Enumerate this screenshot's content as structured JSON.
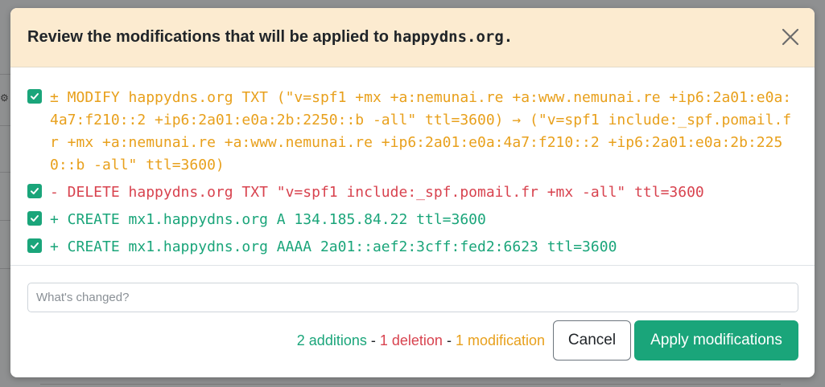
{
  "modal": {
    "title_prefix": "Review the modifications that will be applied to ",
    "title_domain": "happydns.org."
  },
  "changes": [
    {
      "checked": true,
      "kind": "modify",
      "text": "± MODIFY happydns.org TXT (\"v=spf1 +mx +a:nemunai.re +a:www.nemunai.re +ip6:2a01:e0a:4a7:f210::2 +ip6:2a01:e0a:2b:2250::b -all\" ttl=3600) → (\"v=spf1 include:_spf.pomail.fr +mx +a:nemunai.re +a:www.nemunai.re +ip6:2a01:e0a:4a7:f210::2 +ip6:2a01:e0a:2b:2250::b -all\" ttl=3600)"
    },
    {
      "checked": true,
      "kind": "delete",
      "text": "- DELETE happydns.org TXT \"v=spf1 include:_spf.pomail.fr +mx -all\" ttl=3600"
    },
    {
      "checked": true,
      "kind": "create",
      "text": "+ CREATE mx1.happydns.org A 134.185.84.22 ttl=3600"
    },
    {
      "checked": true,
      "kind": "create",
      "text": "+ CREATE mx1.happydns.org AAAA 2a01::aef2:3cff:fed2:6623 ttl=3600"
    }
  ],
  "footer": {
    "commit_placeholder": "What's changed?",
    "commit_value": "",
    "summary": {
      "additions": "2 additions",
      "deletions": "1 deletion",
      "modifications": "1 modification",
      "separator": " - "
    },
    "cancel_label": "Cancel",
    "apply_label": "Apply modifications"
  },
  "colors": {
    "header_bg": "#fcebd0",
    "create": "#1aa57a",
    "delete": "#d8434f",
    "modify": "#e8a01c",
    "primary_button": "#1aa57a"
  },
  "icons": {
    "close": "close-icon",
    "check": "check-icon"
  }
}
